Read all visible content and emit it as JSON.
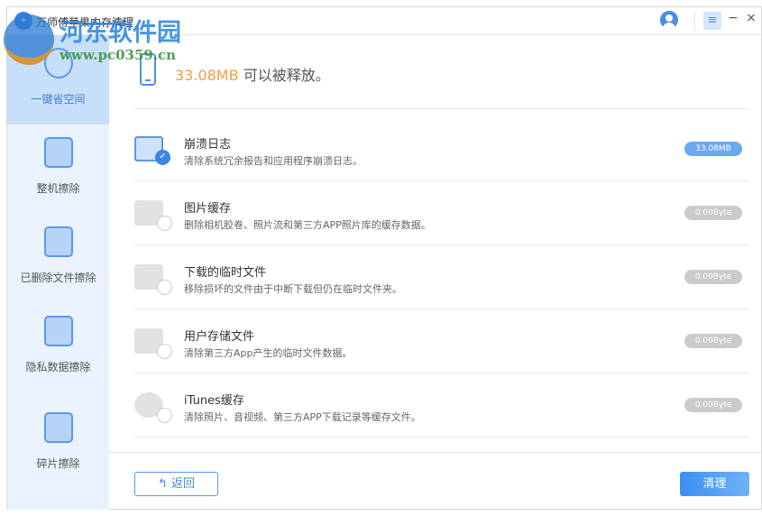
{
  "window": {
    "title": "万师傅苹果内存清理",
    "menu_icon": "≡",
    "minimize": "−",
    "close": "×"
  },
  "watermark": {
    "name": "河东软件园",
    "url": "www.pc0359.cn"
  },
  "sidebar": {
    "items": [
      {
        "label": "一键省空间",
        "icon": "broom-icon",
        "active": true
      },
      {
        "label": "整机擦除",
        "icon": "phone-eraser-icon"
      },
      {
        "label": "已删除文件擦除",
        "icon": "shredder-icon"
      },
      {
        "label": "隐私数据擦除",
        "icon": "lock-shredder-icon"
      },
      {
        "label": "碎片擦除",
        "icon": "app-folder-icon"
      }
    ]
  },
  "summary": {
    "size": "33.08MB",
    "text": "可以被释放。"
  },
  "items": [
    {
      "title": "崩溃日志",
      "desc": "清除系统冗余报告和应用程序崩溃日志。",
      "size": "33.08MB",
      "checked": true
    },
    {
      "title": "图片缓存",
      "desc": "删除相机胶卷、照片流和第三方APP照片库的缓存数据。",
      "size": "0.00Byte",
      "checked": false
    },
    {
      "title": "下载的临时文件",
      "desc": "移除损坏的文件由于中断下载但仍在临时文件夹。",
      "size": "0.00Byte",
      "checked": false
    },
    {
      "title": "用户存储文件",
      "desc": "清除第三方App产生的临时文件数据。",
      "size": "0.00Byte",
      "checked": false
    },
    {
      "title": "iTunes缓存",
      "desc": "清除照片、音视频、第三方APP下载记录等缓存文件。",
      "size": "0.00Byte",
      "checked": false
    }
  ],
  "footer": {
    "back_icon": "↰",
    "back": "返回",
    "clean": "清理"
  },
  "colors": {
    "accent": "#3d86e8",
    "size_highlight": "#f0a040",
    "sidebar_bg": "#e9f2fd"
  }
}
